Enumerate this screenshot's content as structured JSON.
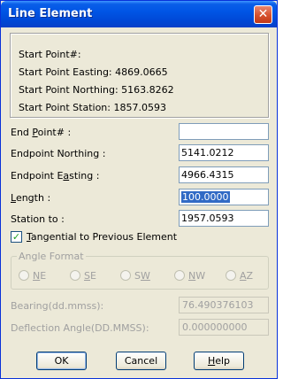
{
  "window": {
    "title": "Line Element",
    "close_glyph": "✕"
  },
  "info": {
    "start_point": "Start Point#:",
    "easting": "Start Point Easting: 4869.0665",
    "northing": "Start Point Northing: 5163.8262",
    "station": "Start Point Station: 1857.0593"
  },
  "fields": {
    "end_point": {
      "label_pre": "End ",
      "label_u": "P",
      "label_post": "oint# :",
      "value": ""
    },
    "endpoint_northing": {
      "label": "Endpoint Northing :",
      "value": "5141.0212"
    },
    "endpoint_easting": {
      "label_pre": "Endpoint E",
      "label_u": "a",
      "label_post": "sting :",
      "value": "4966.4315"
    },
    "length": {
      "label_u": "L",
      "label_post": "ength :",
      "value": "100.0000"
    },
    "station_to": {
      "label": "Station to :",
      "value": "1957.0593"
    }
  },
  "tangential": {
    "checked": true,
    "label_u": "T",
    "label_post": "angential to Previous Element",
    "check_glyph": "✓"
  },
  "angle_format": {
    "title": "Angle Format",
    "options": [
      {
        "pre": "",
        "u": "N",
        "post": "E"
      },
      {
        "pre": "",
        "u": "S",
        "post": "E"
      },
      {
        "pre": "S",
        "u": "W",
        "post": ""
      },
      {
        "pre": "",
        "u": "N",
        "post": "W"
      },
      {
        "pre": "",
        "u": "A",
        "post": "Z"
      }
    ]
  },
  "bearing": {
    "label": "Bearing(dd.mmss):",
    "value": "76.490376103"
  },
  "deflection": {
    "label": "Deflection Angle(DD.MMSS):",
    "value": "0.000000000"
  },
  "buttons": {
    "ok": "OK",
    "cancel": "Cancel",
    "help_u": "H",
    "help_post": "elp"
  }
}
